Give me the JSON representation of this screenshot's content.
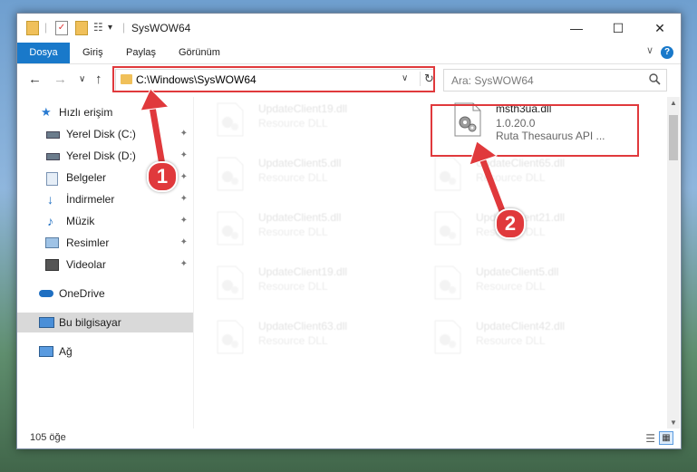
{
  "window": {
    "title": "SysWOW64",
    "minimize_glyph": "—",
    "maximize_glyph": "☐",
    "close_glyph": "✕"
  },
  "ribbon": {
    "tabs": [
      "Dosya",
      "Giriş",
      "Paylaş",
      "Görünüm"
    ],
    "help": "?",
    "collapse": "∨"
  },
  "nav": {
    "back": "←",
    "forward": "→",
    "recent": "∨",
    "up": "↑"
  },
  "address": {
    "path": "C:\\Windows\\SysWOW64",
    "drop": "∨",
    "refresh": "↻"
  },
  "search": {
    "placeholder": "Ara: SysWOW64",
    "icon": "search-icon"
  },
  "sidebar": {
    "items": [
      {
        "label": "Hızlı erişim",
        "icon": "star-icon",
        "pinned": false
      },
      {
        "label": "Yerel Disk (C:)",
        "icon": "drive-icon",
        "pinned": true
      },
      {
        "label": "Yerel Disk (D:)",
        "icon": "drive-icon",
        "pinned": true
      },
      {
        "label": "Belgeler",
        "icon": "documents-icon",
        "pinned": true
      },
      {
        "label": "İndirmeler",
        "icon": "download-icon",
        "pinned": true
      },
      {
        "label": "Müzik",
        "icon": "music-icon",
        "pinned": true
      },
      {
        "label": "Resimler",
        "icon": "pictures-icon",
        "pinned": true
      },
      {
        "label": "Videolar",
        "icon": "video-icon",
        "pinned": true
      },
      {
        "label": "OneDrive",
        "icon": "cloud-icon",
        "pinned": false
      },
      {
        "label": "Bu bilgisayar",
        "icon": "computer-icon",
        "pinned": false,
        "selected": true
      },
      {
        "label": "Ağ",
        "icon": "network-icon",
        "pinned": false
      }
    ],
    "pin_glyph": "📌"
  },
  "files": [
    {
      "name": "UpdateClient19.dll",
      "desc": "Resource DLL",
      "faded": true
    },
    {
      "name": "msth3ua.dll",
      "desc": "1.0.20.0",
      "desc2": "Ruta Thesaurus API ...",
      "faded": false
    },
    {
      "name": "UpdateClient5.dll",
      "desc": "Resource DLL",
      "faded": true
    },
    {
      "name": "UpdateClient65.dll",
      "desc": "Resource DLL",
      "faded": true
    },
    {
      "name": "UpdateClient5.dll",
      "desc": "Resource DLL",
      "faded": true
    },
    {
      "name": "UpdateClient21.dll",
      "desc": "Resource DLL",
      "faded": true
    },
    {
      "name": "UpdateClient19.dll",
      "desc": "Resource DLL",
      "faded": true
    },
    {
      "name": "UpdateClient5.dll",
      "desc": "Resource DLL",
      "faded": true
    },
    {
      "name": "UpdateClient63.dll",
      "desc": "Resource DLL",
      "faded": true
    },
    {
      "name": "UpdateClient42.dll",
      "desc": "Resource DLL",
      "faded": true
    }
  ],
  "status": {
    "count": "105 öğe"
  },
  "annotations": {
    "badge1": "1",
    "badge2": "2",
    "color": "#e0393c"
  }
}
